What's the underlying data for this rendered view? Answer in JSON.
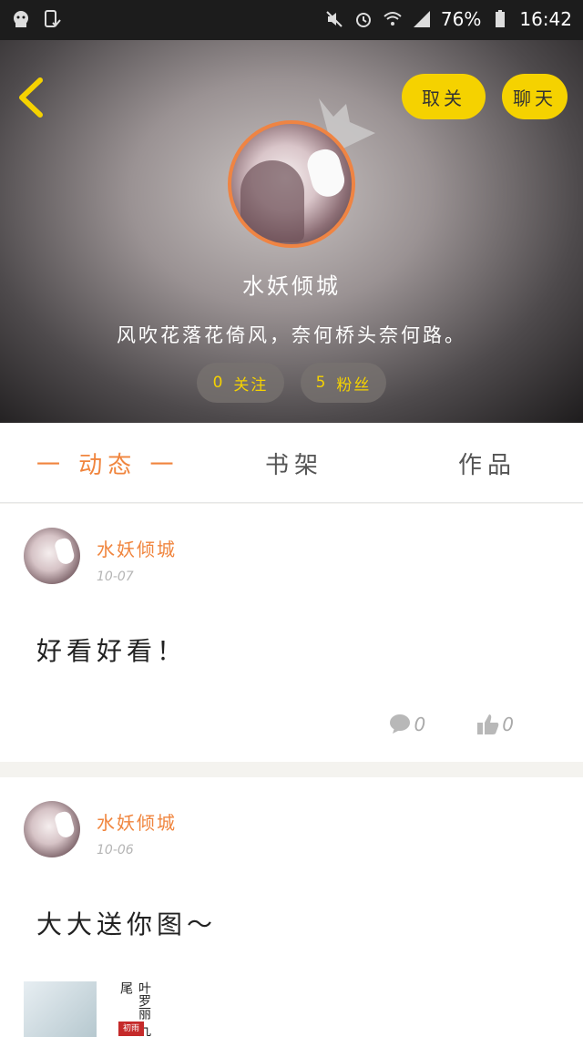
{
  "status_bar": {
    "battery": "76%",
    "time": "16:42"
  },
  "header": {
    "unfollow_label": "取关",
    "chat_label": "聊天",
    "username": "水妖倾城",
    "bio": "风吹花落花倚风，奈何桥头奈何路。",
    "following_count": "0",
    "following_label": "关注",
    "fans_count": "5",
    "fans_label": "粉丝"
  },
  "tabs": [
    {
      "label": "一 动态 一"
    },
    {
      "label": "书架"
    },
    {
      "label": "作品"
    }
  ],
  "posts": [
    {
      "author": "水妖倾城",
      "date": "10-07",
      "text": "好看好看！",
      "comments": "0",
      "likes": "0"
    },
    {
      "author": "水妖倾城",
      "date": "10-06",
      "text": "大大送你图～",
      "thumb_title": "叶罗丽",
      "thumb_sub": "九尾",
      "thumb_tag": "初雨"
    }
  ],
  "colors": {
    "accent": "#f0853e",
    "button_yellow": "#f5d200"
  }
}
